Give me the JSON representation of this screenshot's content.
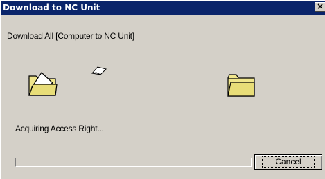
{
  "window": {
    "title": "Download to NC Unit",
    "close_glyph": "×"
  },
  "dialog": {
    "heading": "Download All [Computer to NC Unit]",
    "status": "Acquiring Access Right...",
    "progress_fraction": 0.0,
    "cancel_label": "Cancel"
  },
  "icons": {
    "source_folder": "open-folder-icon",
    "transfer": "flying-document-icon",
    "destination_folder": "folder-icon"
  },
  "colors": {
    "titlebar": "#0a246a",
    "face": "#d4d0c8",
    "folder": "#f0e68c"
  }
}
